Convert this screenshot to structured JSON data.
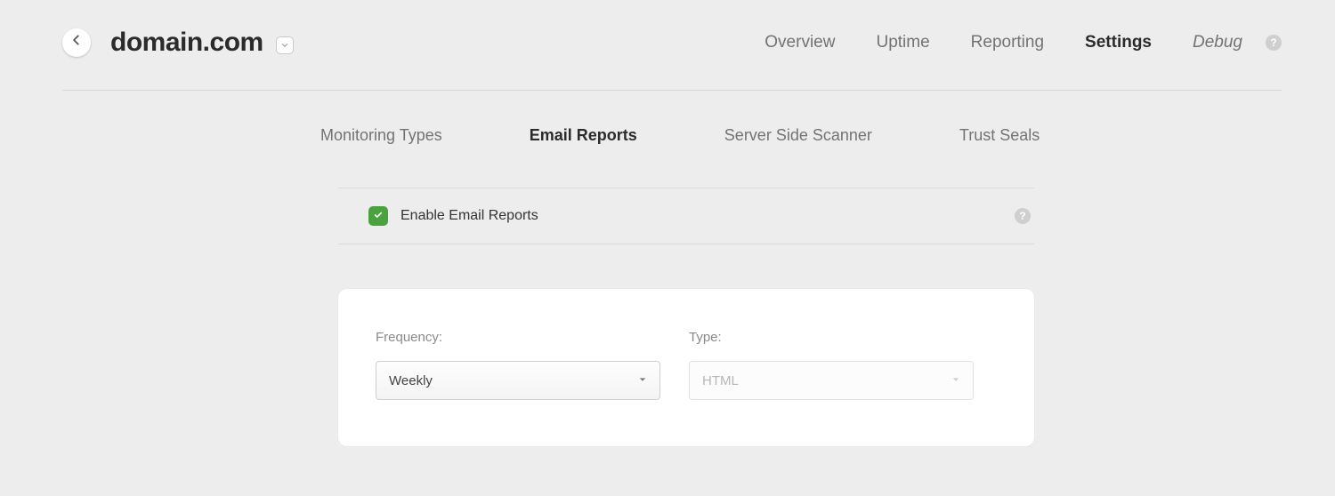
{
  "header": {
    "title": "domain.com"
  },
  "nav": {
    "items": [
      {
        "label": "Overview",
        "active": false
      },
      {
        "label": "Uptime",
        "active": false
      },
      {
        "label": "Reporting",
        "active": false
      },
      {
        "label": "Settings",
        "active": true
      },
      {
        "label": "Debug",
        "active": false,
        "debug": true
      }
    ]
  },
  "subnav": {
    "items": [
      {
        "label": "Monitoring Types",
        "active": false
      },
      {
        "label": "Email Reports",
        "active": true
      },
      {
        "label": "Server Side Scanner",
        "active": false
      },
      {
        "label": "Trust Seals",
        "active": false
      }
    ]
  },
  "enable": {
    "checked": true,
    "label": "Enable Email Reports"
  },
  "form": {
    "frequency": {
      "label": "Frequency:",
      "value": "Weekly"
    },
    "type": {
      "label": "Type:",
      "value": "HTML",
      "disabled": true
    }
  }
}
